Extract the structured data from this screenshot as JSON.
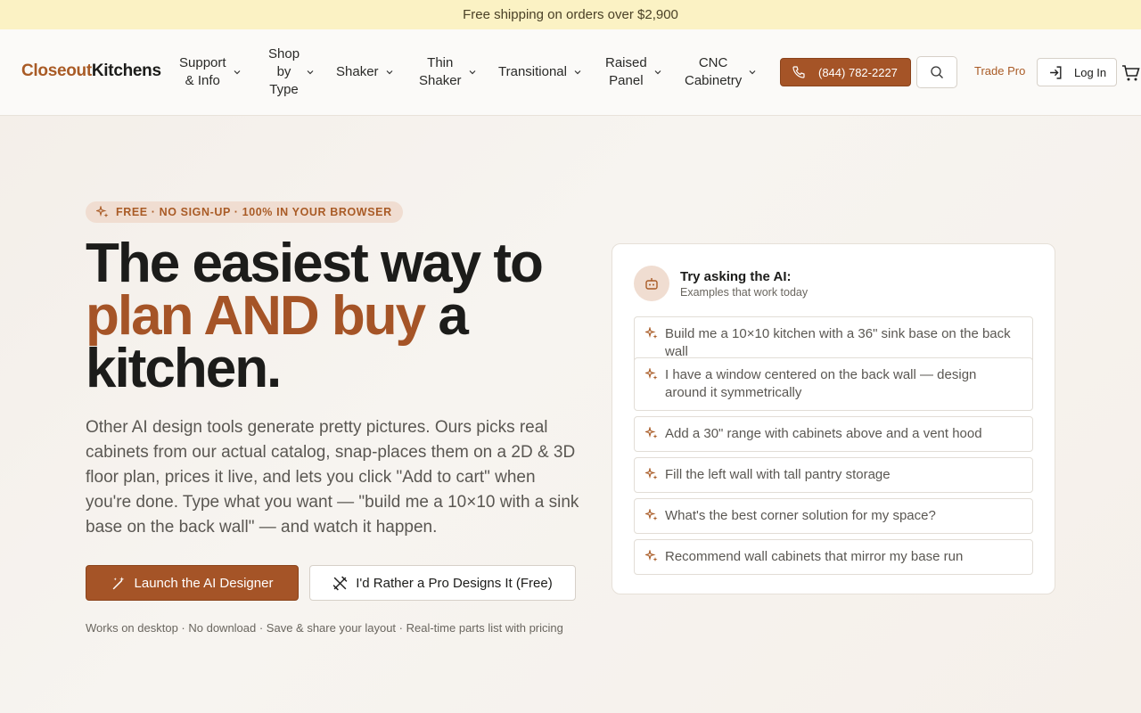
{
  "promo": {
    "text": "Free shipping on orders over $2,900"
  },
  "logo": {
    "part1": "Closeout",
    "part2": "Kitchens"
  },
  "nav": {
    "items": [
      {
        "line1": "Support",
        "line2": "& Info",
        "line3": ""
      },
      {
        "line1": "Shop",
        "line2": "by",
        "line3": "Type"
      },
      {
        "line1": "Shaker",
        "line2": "",
        "line3": ""
      },
      {
        "line1": "Thin",
        "line2": "Shaker",
        "line3": ""
      },
      {
        "line1": "Transitional",
        "line2": "",
        "line3": ""
      },
      {
        "line1": "Raised",
        "line2": "Panel",
        "line3": ""
      },
      {
        "line1": "CNC",
        "line2": "Cabinetry",
        "line3": ""
      }
    ],
    "phone": "(844) 782-2227",
    "trade": "Trade Pro",
    "login": "Log In"
  },
  "hero": {
    "badge": "FREE · NO SIGN-UP · 100% IN YOUR BROWSER",
    "headline_1": "The easiest way to",
    "headline_accent": "plan AND buy",
    "headline_2": " a",
    "headline_3": "kitchen.",
    "lead": "Other AI design tools generate pretty pictures. Ours picks real cabinets from our actual catalog, snap-places them on a 2D & 3D floor plan, prices it live, and lets you click \"Add to cart\" when you're done. Type what you want — \"build me a 10×10 with a sink base on the back wall\" — and watch it happen.",
    "cta_primary": "Launch the AI Designer",
    "cta_secondary": "I'd Rather a Pro Designs It (Free)",
    "features": "Works on desktop · No download · Save & share your layout · Real-time parts list with pricing"
  },
  "assistant": {
    "title": "Try asking the AI:",
    "subtitle": "Examples that work today",
    "prompts": [
      "Build me a 10×10 kitchen with a 36\" sink base on the back wall",
      "I have a window centered on the back wall — design around it symmetrically",
      "Add a 30\" range with cabinets above and a vent hood",
      "Fill the left wall with tall pantry storage",
      "What's the best corner solution for my space?",
      "Recommend wall cabinets that mirror my base run"
    ]
  },
  "colors": {
    "accent": "#a55427",
    "promo_bg": "#fbf2c4",
    "badge_bg": "#f0ddd1"
  },
  "icons": [
    "chevron-down-icon",
    "phone-icon",
    "search-icon",
    "login-icon",
    "cart-icon",
    "sparkle-icon",
    "bot-icon",
    "magic-wand-icon",
    "tools-icon"
  ]
}
